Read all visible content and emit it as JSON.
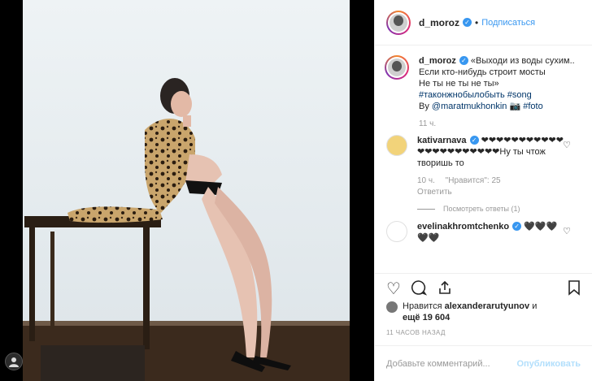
{
  "post": {
    "username": "d_moroz",
    "follow_label": "Подписаться",
    "dot": "•"
  },
  "caption": {
    "username": "d_moroz",
    "line1": "«Выходи из воды сухим..",
    "line2": "Если кто-нибудь строит мосты",
    "line3": "Не ты не ты не ты»",
    "hashtags1": "#таконжнобылобыть #song",
    "by": "By",
    "by_user": "@maratmukhonkin",
    "by_emoji": "📷",
    "foto": "#foto",
    "time": "11 ч."
  },
  "comments": [
    {
      "username": "kativarnava",
      "text": "❤❤❤❤❤❤❤❤❤❤❤❤❤❤❤❤❤❤❤❤❤❤Ну ты чтож творишь то",
      "time": "10 ч.",
      "likes": "\"Нравится\": 25",
      "reply": "Ответить",
      "replies": "Посмотреть ответы (1)"
    },
    {
      "username": "evelinakhromtchenko",
      "text": "🖤🖤🖤🖤🖤"
    }
  ],
  "likes": {
    "prefix": "Нравится",
    "user": "alexanderarutyunov",
    "and": "и",
    "more": "ещё 19 604"
  },
  "timestamp": "11 ЧАСОВ НАЗАД",
  "add_comment": {
    "placeholder": "Добавьте комментарий...",
    "publish": "Опубликовать"
  },
  "icons": [
    "verified-icon",
    "heart-icon",
    "comment-icon",
    "share-icon",
    "bookmark-icon",
    "avatar-icon"
  ],
  "colors": {
    "accent": "#3897f0",
    "publish_disabled": "#b2dffc",
    "muted": "#999999"
  }
}
